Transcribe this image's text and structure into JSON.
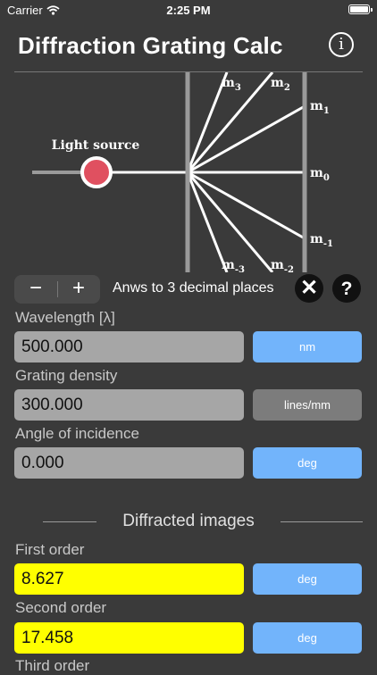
{
  "status_bar": {
    "carrier": "Carrier",
    "time": "2:25 PM",
    "wifi_icon": "wifi-icon",
    "battery_icon": "battery-icon"
  },
  "header": {
    "title": "Diffraction Grating Calc",
    "info_label": "i"
  },
  "diagram": {
    "light_source_label": "Light source",
    "orders": [
      {
        "base": "m",
        "sub": "3"
      },
      {
        "base": "m",
        "sub": "2"
      },
      {
        "base": "m",
        "sub": "1"
      },
      {
        "base": "m",
        "sub": "0"
      },
      {
        "base": "m",
        "sub": "-1"
      },
      {
        "base": "m",
        "sub": "-2"
      },
      {
        "base": "m",
        "sub": "-3"
      }
    ],
    "colors": {
      "source": "#e05060",
      "rays": "#ffffff",
      "grating": "#9a9a9a"
    }
  },
  "controls": {
    "minus_label": "−",
    "plus_label": "+",
    "decimals_text": "Anws to 3 decimal places",
    "clear_label": "✕",
    "help_label": "?"
  },
  "inputs": {
    "wavelength": {
      "label": "Wavelength [λ]",
      "value": "500.000",
      "unit": "nm"
    },
    "density": {
      "label": "Grating density",
      "value": "300.000",
      "unit": "lines/mm"
    },
    "incidence": {
      "label": "Angle of incidence",
      "value": "0.000",
      "unit": "deg"
    }
  },
  "results": {
    "heading": "Diffracted images",
    "first": {
      "label": "First order",
      "value": "8.627",
      "unit": "deg"
    },
    "second": {
      "label": "Second order",
      "value": "17.458",
      "unit": "deg"
    },
    "third": {
      "label": "Third order"
    }
  },
  "colors": {
    "background": "#3a3a3a",
    "accent_blue": "#72b4fb",
    "result_yellow": "#ffff00",
    "input_gray": "#a6a6a6"
  }
}
